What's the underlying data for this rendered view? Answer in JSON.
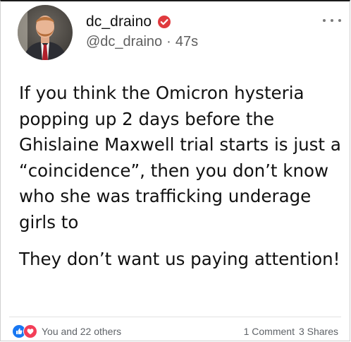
{
  "post": {
    "author": {
      "display_name": "dc_draino",
      "handle": "@dc_draino",
      "separator": "·",
      "timestamp": "47s",
      "verified": true
    },
    "paragraphs": [
      "If you think the Omicron hysteria popping up 2 days before the Ghislaine Maxwell trial starts is just a “coincidence”, then you don’t know who she was trafficking underage girls to",
      "They don’t want us paying attention!"
    ],
    "footer": {
      "reactions_label": "You and 22 others",
      "comments_label": "1 Comment",
      "shares_label": "3 Shares"
    }
  },
  "icons": {
    "more": "more-options-icon",
    "verified": "verified-badge-icon",
    "reaction_like": "like-reaction-icon",
    "reaction_love": "love-reaction-icon"
  },
  "colors": {
    "verified_badge": "#e03a3e",
    "like_blue": "#1877f2",
    "love_red": "#f33e58",
    "text_primary": "#111111",
    "text_secondary": "#5f5f5f"
  }
}
